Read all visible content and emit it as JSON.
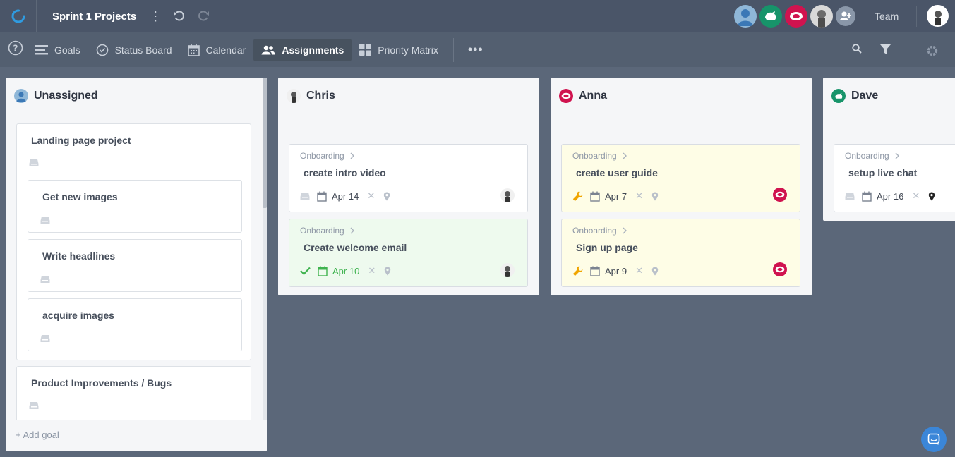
{
  "header": {
    "project_title": "Sprint 1 Projects",
    "team_label": "Team"
  },
  "nav": {
    "items": [
      {
        "label": "Goals",
        "icon": "list-icon"
      },
      {
        "label": "Status Board",
        "icon": "check-circle-icon"
      },
      {
        "label": "Calendar",
        "icon": "calendar-icon"
      },
      {
        "label": "Assignments",
        "icon": "people-icon",
        "active": true
      },
      {
        "label": "Priority Matrix",
        "icon": "grid-icon"
      }
    ]
  },
  "colors": {
    "accent": "#2f9be0",
    "brand_red": "#d0134f",
    "brand_green": "#17946a",
    "done_green": "#3fb34f",
    "in_progress": "#f0a500"
  },
  "columns": {
    "unassigned": {
      "name": "Unassigned",
      "goals": [
        {
          "title": "Landing page project",
          "subgoals": [
            "Get new images",
            "Write headlines",
            "acquire images"
          ]
        },
        {
          "title": "Product Improvements / Bugs"
        }
      ],
      "add_goal": "+ Add goal"
    },
    "chris": {
      "name": "Chris",
      "tasks": [
        {
          "crumb": "Onboarding",
          "title": "create intro video",
          "date": "Apr 14",
          "status": "none"
        },
        {
          "crumb": "Onboarding",
          "title": "Create welcome email",
          "date": "Apr 10",
          "status": "done"
        }
      ]
    },
    "anna": {
      "name": "Anna",
      "tasks": [
        {
          "crumb": "Onboarding",
          "title": "create user guide",
          "date": "Apr 7",
          "status": "in-progress"
        },
        {
          "crumb": "Onboarding",
          "title": "Sign up page",
          "date": "Apr 9",
          "status": "in-progress"
        }
      ]
    },
    "dave": {
      "name": "Dave",
      "tasks": [
        {
          "crumb": "Onboarding",
          "title": "setup live chat",
          "date": "Apr 16",
          "status": "none"
        }
      ]
    }
  }
}
